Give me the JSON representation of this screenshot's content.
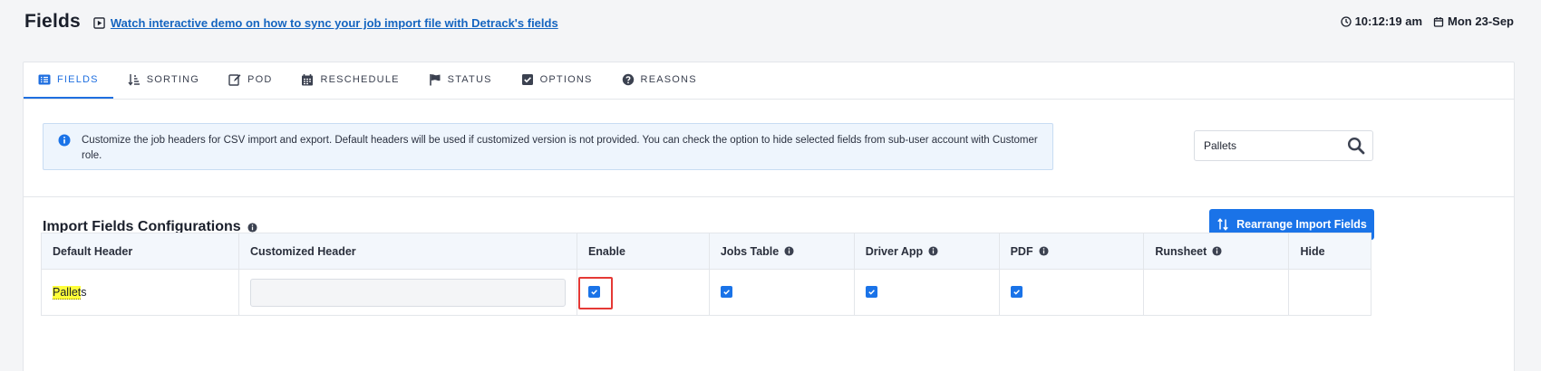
{
  "header": {
    "title": "Fields",
    "demo_link": "Watch interactive demo on how to sync your job import file with Detrack's fields",
    "time": "10:12:19 am",
    "date": "Mon 23-Sep"
  },
  "tabs": [
    {
      "label": "FIELDS",
      "icon": "list-icon",
      "active": true
    },
    {
      "label": "SORTING",
      "icon": "sort-icon"
    },
    {
      "label": "POD",
      "icon": "edit-icon"
    },
    {
      "label": "RESCHEDULE",
      "icon": "calendar-icon"
    },
    {
      "label": "STATUS",
      "icon": "flag-icon"
    },
    {
      "label": "OPTIONS",
      "icon": "checkbox-icon"
    },
    {
      "label": "REASONS",
      "icon": "question-icon"
    }
  ],
  "info": {
    "text": "Customize the job headers for CSV import and export. Default headers will be used if customized version is not provided. You can check the option to hide selected fields from sub-user account with Customer role."
  },
  "search": {
    "value": "Pallets"
  },
  "section": {
    "title": "Import Fields Configurations",
    "rearrange_label": "Rearrange Import Fields"
  },
  "table": {
    "columns": [
      "Default Header",
      "Customized Header",
      "Enable",
      "Jobs Table",
      "Driver App",
      "PDF",
      "Runsheet",
      "Hide"
    ],
    "rows": [
      {
        "default_header_highlight": "Pallet",
        "default_header_rest": "s",
        "customized_header": "",
        "enable": true,
        "jobs_table": true,
        "driver_app": true,
        "pdf": true,
        "runsheet": false,
        "hide": false
      }
    ]
  },
  "colors": {
    "accent": "#1a73e8",
    "highlight": "#ffff3a",
    "focus": "#e53935"
  }
}
